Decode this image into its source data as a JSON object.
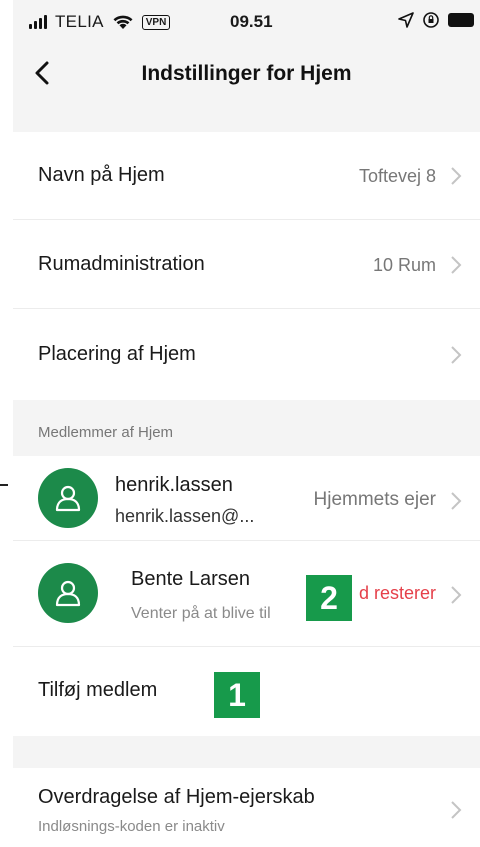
{
  "status_bar": {
    "carrier": "TELIA",
    "vpn": "VPN",
    "time": "09.51"
  },
  "header": {
    "title": "Indstillinger for Hjem"
  },
  "settings": [
    {
      "label": "Navn på Hjem",
      "value": "Toftevej 8"
    },
    {
      "label": "Rumadministration",
      "value": "10 Rum"
    },
    {
      "label": "Placering af Hjem",
      "value": ""
    }
  ],
  "members_section": {
    "header": "Medlemmer af Hjem",
    "members": [
      {
        "name": "henrik.lassen",
        "sub": "henrik.lassen@...",
        "role": "Hjemmets ejer"
      },
      {
        "name": "Bente Larsen",
        "sub": "Venter på at blive til",
        "role": "d resterer"
      }
    ],
    "add_member": "Tilføj medlem"
  },
  "ownership": {
    "label": "Overdragelse af Hjem-ejerskab",
    "sub": "Indløsnings-koden er inaktiv"
  },
  "badges": [
    "1",
    "2"
  ],
  "colors": {
    "accent_green": "#1c8a4a",
    "badge_green": "#179a4b",
    "pending_red": "#e5404a",
    "background": "#f4f4f4"
  }
}
